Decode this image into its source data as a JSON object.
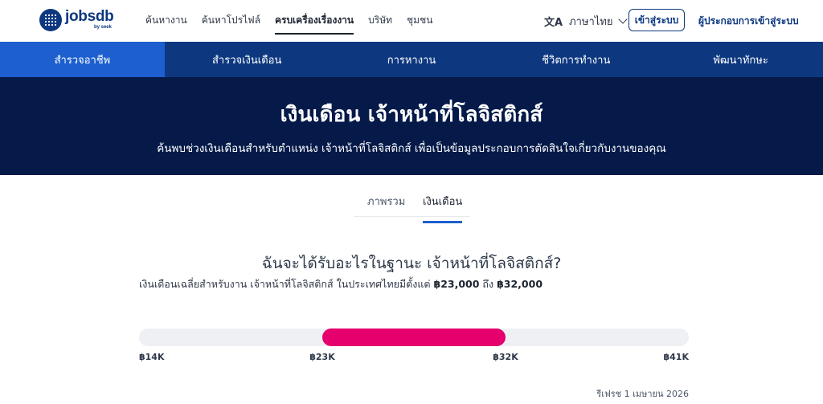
{
  "header": {
    "logo": {
      "word": "jobsdb",
      "sub": "by seek"
    },
    "menu": [
      {
        "label": "ค้นหางาน",
        "active": false
      },
      {
        "label": "ค้นหาโปรไฟล์",
        "active": false
      },
      {
        "label": "ครบเครื่องเรื่องงาน",
        "active": true
      },
      {
        "label": "บริษัท",
        "active": false
      },
      {
        "label": "ชุมชน",
        "active": false
      }
    ],
    "language": {
      "icon": "translate-icon",
      "label": "ภาษาไทย"
    },
    "login_label": "เข้าสู่ระบบ",
    "employer_label": "ผู้ประกอบการเข้าสู่ระบบ"
  },
  "subnav": [
    {
      "label": "สำรวจอาชีพ",
      "active": true
    },
    {
      "label": "สำรวจเงินเดือน",
      "active": false
    },
    {
      "label": "การหางาน",
      "active": false
    },
    {
      "label": "ชีวิตการทำงาน",
      "active": false
    },
    {
      "label": "พัฒนาทักษะ",
      "active": false
    }
  ],
  "hero": {
    "title": "เงินเดือน เจ้าหน้าที่โลจิสติกส์",
    "subtitle": "ค้นพบช่วงเงินเดือนสำหรับตำแหน่ง เจ้าหน้าที่โลจิสติกส์ เพื่อเป็นข้อมูลประกอบการตัดสินใจเกี่ยวกับงานของคุณ"
  },
  "tabs": [
    {
      "label": "ภาพรวม",
      "active": false
    },
    {
      "label": "เงินเดือน",
      "active": true
    }
  ],
  "salary": {
    "question": "ฉันจะได้รับอะไรในฐานะ เจ้าหน้าที่โลจิสติกส์?",
    "desc_prefix": "เงินเดือนเฉลี่ยสำหรับงาน เจ้าหน้าที่โลจิสติกส์ ในประเทศไทยมีตั้งแต่ ",
    "low_label": "฿23,000",
    "desc_mid": " ถึง ",
    "high_label": "฿32,000",
    "range": {
      "scale_min": 14,
      "scale_max": 41,
      "low": 23,
      "high": 32,
      "unit": "K"
    },
    "ticks": [
      "฿14K",
      "฿23K",
      "฿32K",
      "฿41K"
    ],
    "bar_color": "#e5006e",
    "updated": "รีเฟรช 1 เมษายน 2026"
  },
  "colors": {
    "brand": "#0d3880",
    "subnav_active": "#1d5fce",
    "hero_bg": "#051a49"
  }
}
